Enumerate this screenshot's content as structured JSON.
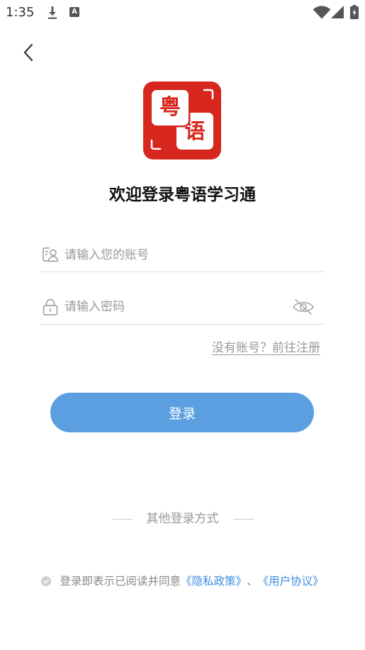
{
  "theme": {
    "brand_red": "#d7261e",
    "primary_button": "#5b9fe0",
    "link_blue": "#3b8de0",
    "text_muted": "#999999"
  },
  "status_bar": {
    "time": "1:35",
    "a_icon_letter": "A",
    "left_icons": [
      "download-icon",
      "a-box-icon"
    ],
    "right_icons": [
      "wifi-icon",
      "signal-icon",
      "battery-charging-icon"
    ]
  },
  "nav": {
    "back_icon": "chevron-left-icon"
  },
  "logo": {
    "char_top": "粤",
    "char_bottom": "语"
  },
  "title": "欢迎登录粤语学习通",
  "form": {
    "account": {
      "icon": "user-card-icon",
      "placeholder": "请输入您的账号",
      "value": ""
    },
    "password": {
      "icon": "lock-icon",
      "placeholder": "请输入密码",
      "value": "",
      "visibility_icon": "eye-off-icon",
      "masked": true
    },
    "register_link": "没有账号？前往注册",
    "login_button": "登录"
  },
  "other_login": {
    "label": "其他登录方式"
  },
  "agreement": {
    "checked": false,
    "check_icon": "check-circle-icon",
    "prefix": "登录即表示已阅读并同意",
    "privacy_link": "《隐私政策》",
    "separator": "、",
    "terms_link": "《用户协议》"
  }
}
